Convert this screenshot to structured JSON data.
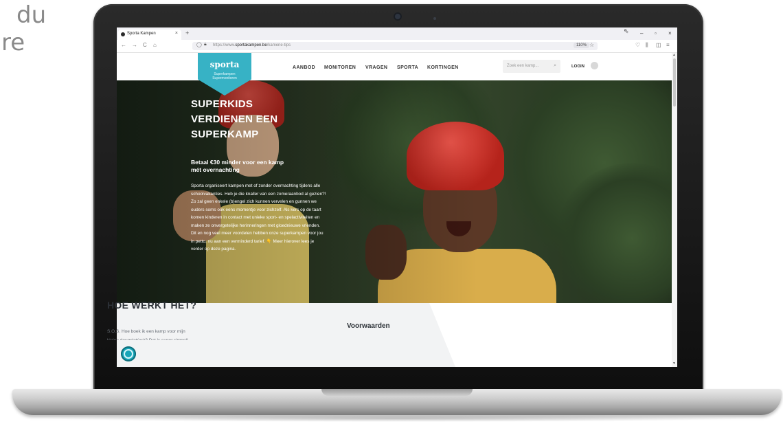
{
  "edge_text": {
    "line1": "du",
    "line2": "re"
  },
  "browser": {
    "tab_title": "Sporta Kampen",
    "tab_close": "×",
    "new_tab": "+",
    "url_prefix": "https://www.",
    "url_domain": "sportakampen.be",
    "url_path": "/kamene-tips",
    "zoom": "110%",
    "nav_back": "←",
    "nav_forward": "→",
    "nav_reload": "C",
    "nav_home": "⌂",
    "win_minimize": "–",
    "win_maximize": "▫",
    "win_close": "×"
  },
  "site": {
    "logo_word": "sporta",
    "logo_sub_line1": "Superkampen",
    "logo_sub_line2": "Supermonitoren",
    "menu": [
      "AANBOD",
      "MONITOREN",
      "VRAGEN",
      "SPORTA",
      "KORTINGEN"
    ],
    "search_placeholder": "Zoek een kamp...",
    "login_label": "LOGIN"
  },
  "hero": {
    "title_line1": "SUPERKIDS",
    "title_line2": "VERDIENEN EEN",
    "title_line3": "SUPERKAMP",
    "subtitle_line1": "Betaal €30 minder voor een kamp",
    "subtitle_line2": "mét overnachting",
    "body_lines": [
      "Sporta organiseert kampen met of zonder overnachting tijdens alle",
      "schoolvakanties. Heb je die knaller van een zomeraanbod al gezien?!",
      "Zo zal geen enkele (b)engel zich kunnen vervelen en gunnen we",
      "ouders soms ook eens momentje voor zichzelf. Als kers op de taart",
      "komen kinderen in contact met unieke sport- en spelactiviteiten en",
      "maken ze onvergetelijke herinneringen met gloednieuwe vrienden.",
      "Dit en nog veel meer voordelen hebben onze superkampen voor jou",
      "in petto, nu aan een verminderd tarief. 👇 Meer hierover lees je",
      "verder op deze pagina."
    ]
  },
  "section": {
    "title": "HOE WERKT HET?",
    "text_line1": "S.O.S. Hoe boek ik een kamp voor mijn",
    "text_line2": "kleine deugniet(en)? Dat is super simpel!",
    "aside_title": "Voorwaarden"
  },
  "colors": {
    "accent": "#37b2c5",
    "fingerprint": "#18a5b8"
  },
  "icons": {
    "fingerprint": "fingerprint-icon",
    "search": "search-icon",
    "avatar": "user-avatar-icon"
  }
}
